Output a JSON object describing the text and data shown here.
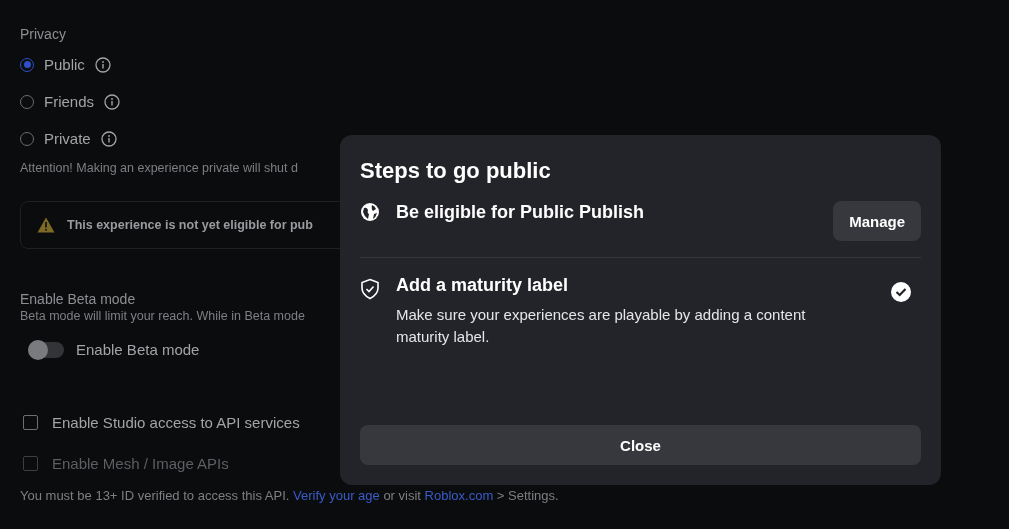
{
  "privacy": {
    "label": "Privacy",
    "options": [
      {
        "label": "Public",
        "selected": true
      },
      {
        "label": "Friends",
        "selected": false
      },
      {
        "label": "Private",
        "selected": false
      }
    ],
    "note": "Attention! Making an experience private will shut d"
  },
  "warning": {
    "text": "This experience is not yet eligible for pub"
  },
  "beta": {
    "title": "Enable Beta mode",
    "description": "Beta mode will limit your reach. While in Beta mode",
    "toggle": {
      "label": "Enable Beta mode",
      "on": false
    }
  },
  "checkboxes": [
    {
      "label": "Enable Studio access to API services",
      "checked": false,
      "disabled": false
    },
    {
      "label": "Enable Mesh / Image APIs",
      "checked": false,
      "disabled": true
    }
  ],
  "age_note": {
    "before": "You must be 13+ ID verified to access this API.",
    "link": "Verify your age",
    "middle": "or visit",
    "link2": "Roblox.com",
    "after": "> Settings."
  },
  "modal": {
    "title": "Steps to go public",
    "steps": [
      {
        "kind": "globe",
        "title": "Be eligible for Public Publish",
        "button": "Manage",
        "done": false
      },
      {
        "kind": "shield",
        "title": "Add a maturity label",
        "description": "Make sure your experiences are playable by adding a content maturity label.",
        "done": true
      }
    ],
    "close": "Close"
  }
}
